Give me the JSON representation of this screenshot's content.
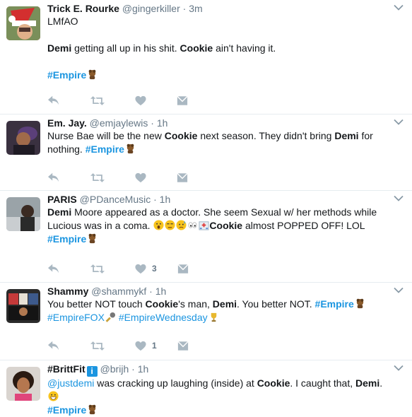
{
  "tweets": [
    {
      "name": "Trick E. Rourke",
      "handle": "@gingerkiller",
      "sep": "·",
      "time": "3m",
      "line1": "LMfAO",
      "l2_b1": "Demi",
      "l2_t1": " getting all up in his shit. ",
      "l2_b2": "Cookie",
      "l2_t2": " ain't having it.",
      "tag": "#Empire"
    },
    {
      "name": "Em. Jay.",
      "handle": "@emjaylewis",
      "sep": "·",
      "time": "1h",
      "t1": "Nurse Bae will be the new ",
      "b1": "Cookie",
      "t2": " next season. They didn't bring ",
      "b2": "Demi",
      "t3": " for",
      "t4": "nothing. ",
      "tag": "#Empire"
    },
    {
      "name": "PARIS",
      "handle": "@PDanceMusic",
      "sep": "·",
      "time": "1h",
      "b1": "Demi",
      "t1": " Moore appeared as a doctor. She seem Sexual w/ her methods while",
      "t2": "Lucious was in a coma. ",
      "b2": "Cookie",
      "t3": " almost POPPED OFF! LOL",
      "tag": "#Empire",
      "likes": "3"
    },
    {
      "name": "Shammy",
      "handle": "@shammykf",
      "sep": "·",
      "time": "1h",
      "t1": "You better NOT touch ",
      "b1": "Cookie",
      "t2": "'s man, ",
      "b2": "Demi",
      "t3": ". You better NOT. ",
      "tag1": "#Empire",
      "tag2": "#EmpireFOX",
      "tag3": "#EmpireWednesday",
      "likes": "1"
    },
    {
      "name": "#BrittFit",
      "handle": "@brijh",
      "sep": "·",
      "time": "1h",
      "mention": "@justdemi",
      "t1": " was cracking up laughing (inside) at ",
      "b1": "Cookie",
      "t2": ". I caught that, ",
      "b2": "Demi",
      "t3": ".",
      "tag": "#Empire"
    }
  ],
  "icons": {
    "reply": "reply-icon",
    "retweet": "retweet-icon",
    "like": "heart-icon",
    "message": "direct-message-icon",
    "caret": "chevron-down-icon",
    "verified_badge": "info-badge-icon"
  },
  "colors": {
    "hashtag": "#1b95e0",
    "meta": "#657786",
    "action": "#aab8c2",
    "divider": "#e6ecf0"
  }
}
